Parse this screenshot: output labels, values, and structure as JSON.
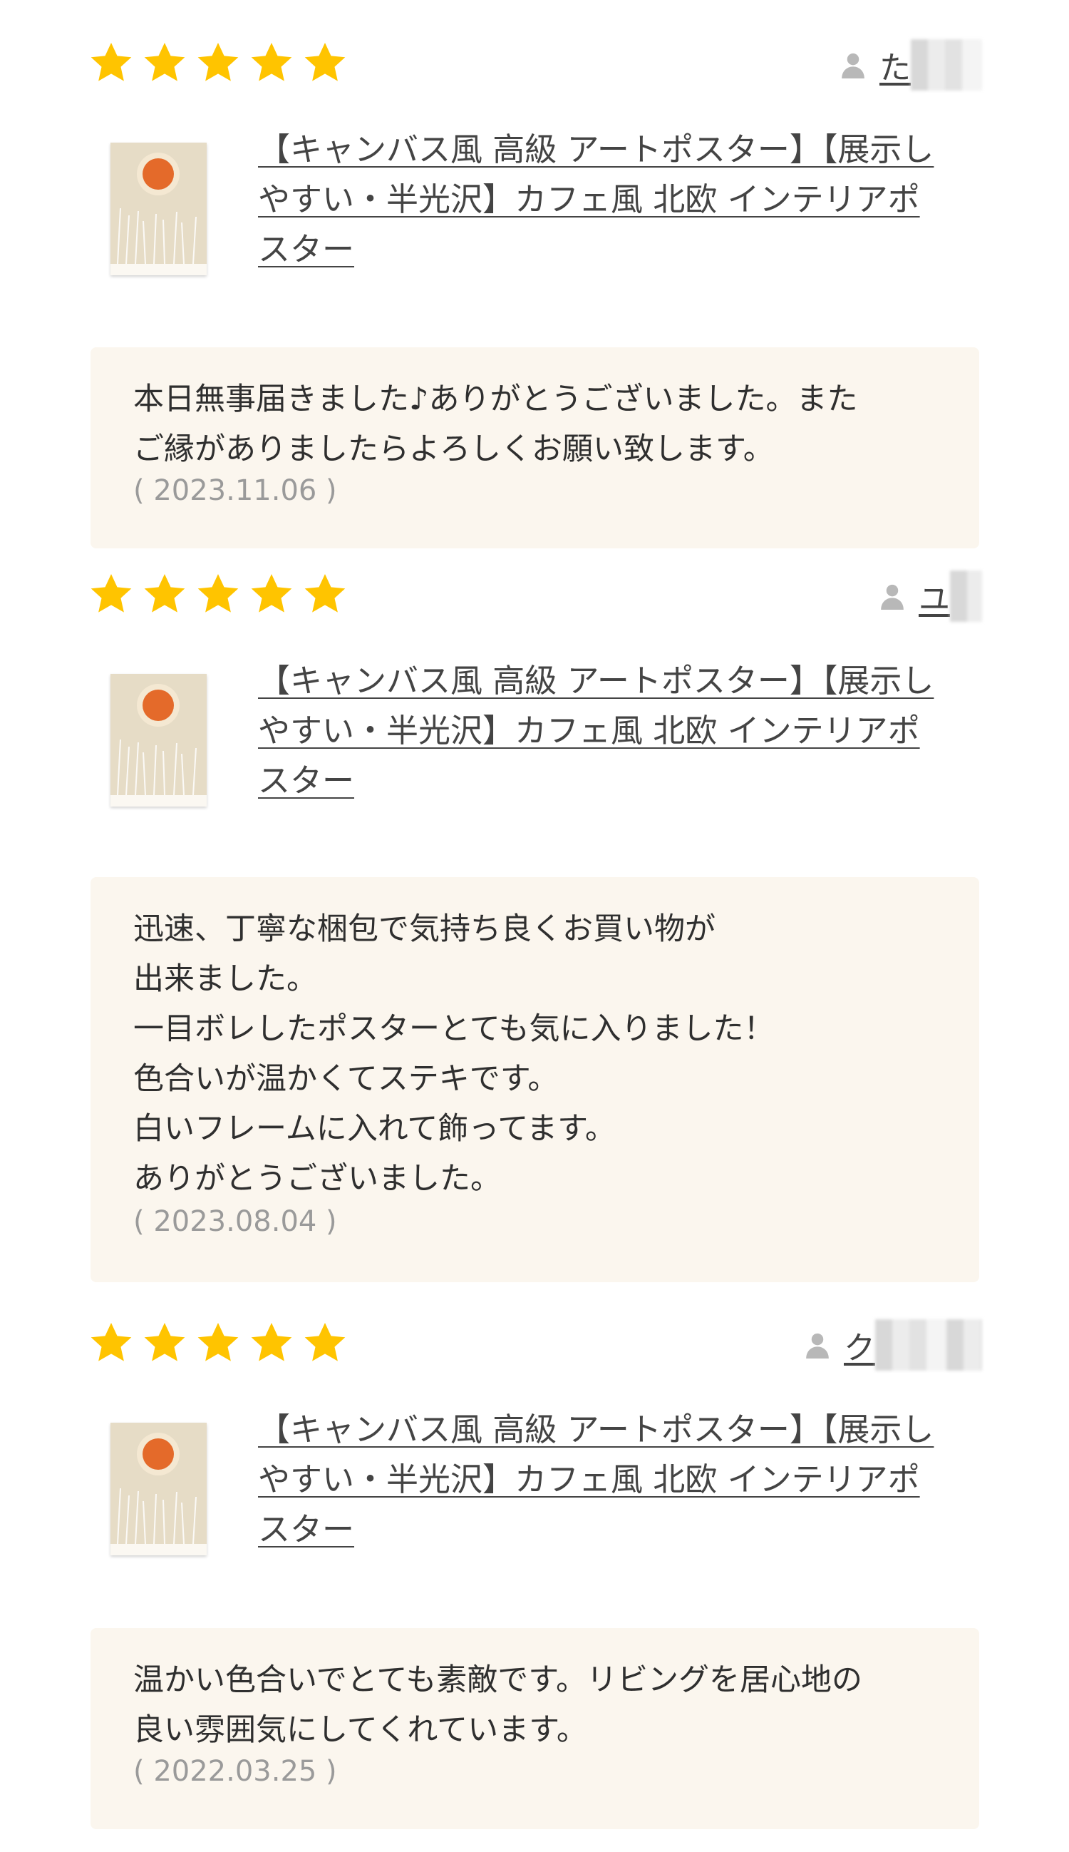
{
  "colors": {
    "star": "#ffc400",
    "comment_bg": "#fbf6ee",
    "thumb_bg": "#e6dcc6",
    "sun": "#e46a2a"
  },
  "icons": {
    "star": "star-icon",
    "user": "user-icon"
  },
  "reviews": [
    {
      "rating": 5,
      "reviewer": "た",
      "product_title": "【キャンバス風 高級 アートポスター】【展示し\nやすい・半光沢】カフェ風 北欧 インテリアポ\nスター",
      "comment": "本日無事届きました♪ありがとうございました。また\nご縁がありましたらよろしくお願い致します。",
      "date": "( 2023.11.06 )"
    },
    {
      "rating": 5,
      "reviewer": "ユ",
      "product_title": "【キャンバス風 高級 アートポスター】【展示し\nやすい・半光沢】カフェ風 北欧 インテリアポ\nスター",
      "comment": "迅速、丁寧な梱包で気持ち良くお買い物が\n出来ました。\n一目ボレしたポスターとても気に入りました！\n色合いが温かくてステキです。\n白いフレームに入れて飾ってます。\nありがとうございました。",
      "date": "( 2023.08.04 )"
    },
    {
      "rating": 5,
      "reviewer": "ク",
      "product_title": "【キャンバス風 高級 アートポスター】【展示し\nやすい・半光沢】カフェ風 北欧 インテリアポ\nスター",
      "comment": "温かい色合いでとても素敵です。リビングを居心地の\n良い雰囲気にしてくれています。",
      "date": "( 2022.03.25 )"
    }
  ]
}
